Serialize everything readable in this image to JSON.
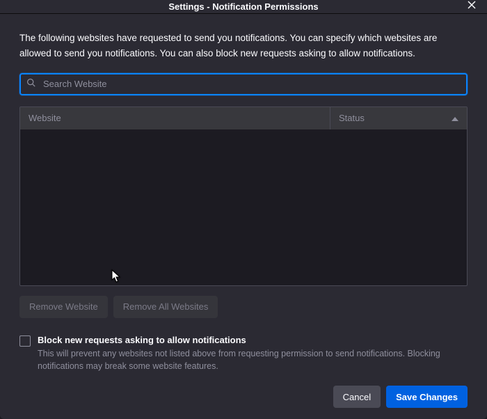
{
  "header": {
    "title": "Settings - Notification Permissions"
  },
  "intro": "The following websites have requested to send you notifications. You can specify which websites are allowed to send you notifications. You can also block new requests asking to allow notifications.",
  "search": {
    "placeholder": "Search Website",
    "value": ""
  },
  "table": {
    "columns": {
      "website": "Website",
      "status": "Status"
    },
    "rows": []
  },
  "actions": {
    "remove_website": "Remove Website",
    "remove_all": "Remove All Websites"
  },
  "block_option": {
    "label": "Block new requests asking to allow notifications",
    "description": "This will prevent any websites not listed above from requesting permission to send notifications. Blocking notifications may break some website features.",
    "checked": false
  },
  "footer": {
    "cancel": "Cancel",
    "save": "Save Changes"
  }
}
